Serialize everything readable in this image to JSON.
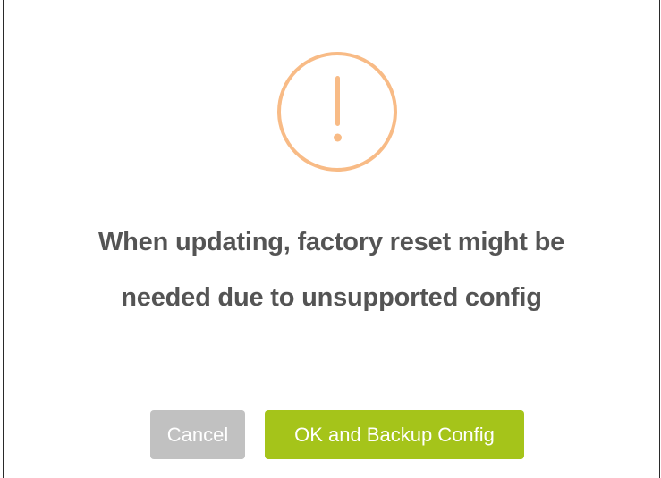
{
  "dialog": {
    "icon": "exclamation-circle-icon",
    "icon_color": "#f8bb86",
    "message_line1": "When updating, factory reset might be",
    "message_line2": "needed due to unsupported config",
    "cancel_label": "Cancel",
    "ok_label": "OK and Backup Config",
    "cancel_color": "#c1c1c1",
    "ok_color": "#a5c41a"
  }
}
